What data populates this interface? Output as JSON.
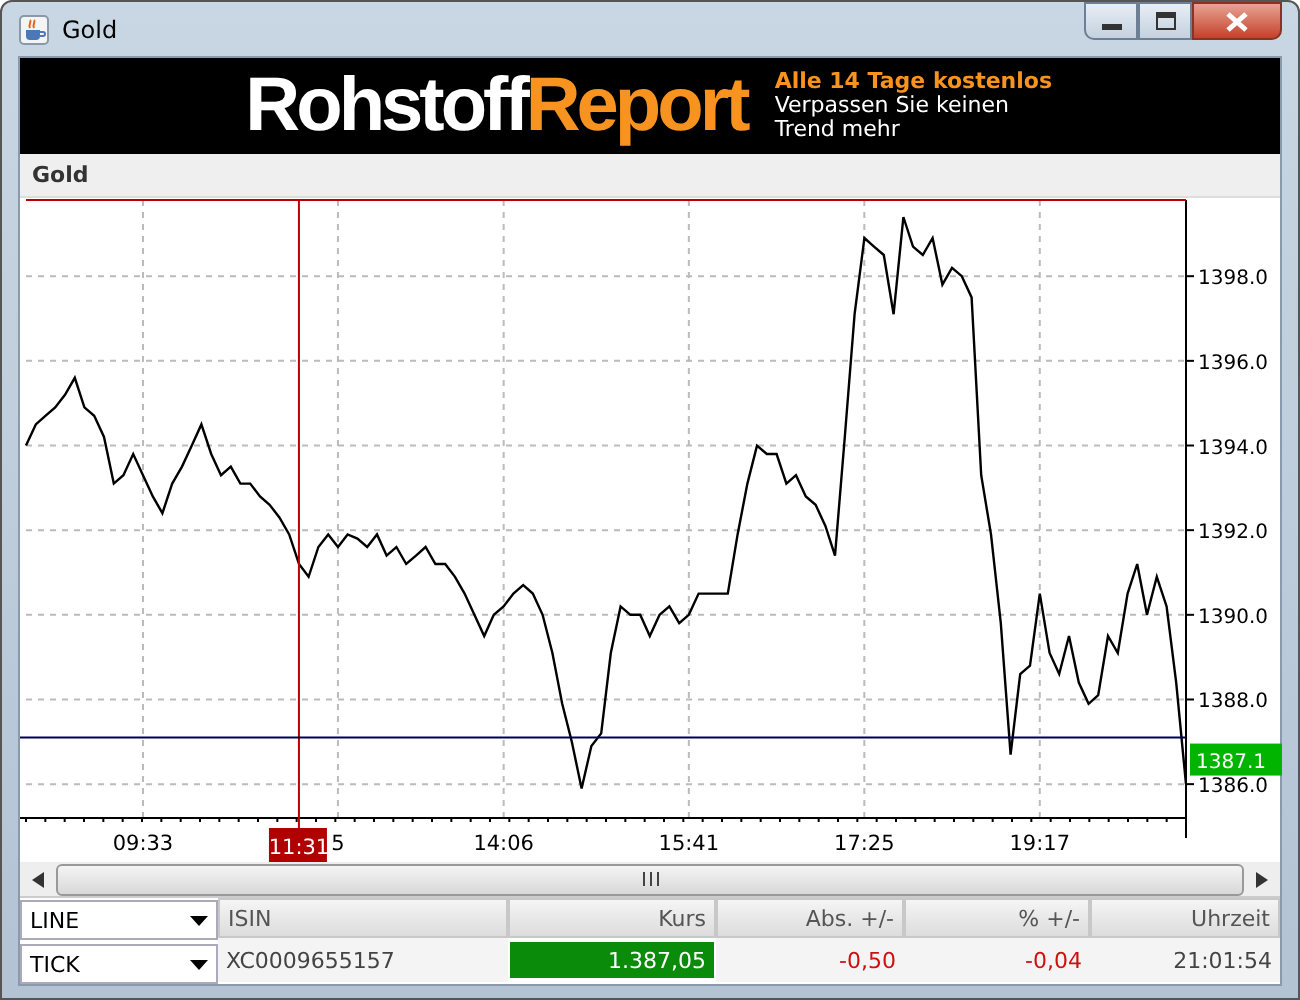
{
  "window": {
    "title": "Gold"
  },
  "banner": {
    "logo": [
      "Rohstoff",
      "Report"
    ],
    "headline": "Alle 14 Tage kostenlos",
    "text": "Verpassen Sie keinen Trend mehr"
  },
  "section": {
    "title": "Gold"
  },
  "chart": {
    "chart_data": {
      "type": "line",
      "grid": true,
      "ylim": [
        1385.2,
        1399.8
      ],
      "categories": [
        null,
        null,
        null,
        null,
        null,
        null,
        null,
        null,
        null,
        null,
        null,
        null,
        "09:33",
        null,
        null,
        null,
        null,
        null,
        null,
        null,
        null,
        null,
        null,
        null,
        null,
        null,
        null,
        null,
        "11:31",
        null,
        null,
        null,
        "5",
        null,
        null,
        null,
        null,
        null,
        null,
        null,
        null,
        null,
        null,
        null,
        null,
        null,
        null,
        null,
        null,
        "14:06",
        null,
        null,
        null,
        null,
        null,
        null,
        null,
        null,
        null,
        null,
        null,
        null,
        null,
        null,
        null,
        null,
        null,
        null,
        "15:41",
        null,
        null,
        null,
        null,
        null,
        null,
        null,
        null,
        null,
        null,
        null,
        null,
        null,
        null,
        null,
        null,
        null,
        "17:25",
        null,
        null,
        null,
        null,
        null,
        null,
        null,
        null,
        null,
        null,
        null,
        null,
        null,
        null,
        null,
        null,
        null,
        "19:17",
        null,
        null,
        null,
        null,
        null,
        null,
        null,
        null,
        null,
        null,
        null,
        null,
        null,
        null,
        null
      ],
      "ref_lines": [
        {
          "axis": "x",
          "value": "11:31",
          "color": "#c00000"
        },
        {
          "axis": "y",
          "value": 1387.1,
          "label": "1387.1",
          "color": "#000050"
        }
      ],
      "yticks": [
        {
          "value": 1386,
          "label": "1386.0"
        },
        {
          "value": 1388,
          "label": "1388.0"
        },
        {
          "value": 1390,
          "label": "1390.0"
        },
        {
          "value": 1392,
          "label": "1392.0"
        },
        {
          "value": 1394,
          "label": "1394.0"
        },
        {
          "value": 1396,
          "label": "1396.0"
        },
        {
          "value": 1398,
          "label": "1398.0"
        }
      ],
      "series": [
        {
          "color": "#000000",
          "values": [
            1394.0,
            1394.5,
            1394.7,
            1394.9,
            1395.2,
            1395.6,
            1394.9,
            1394.7,
            1394.2,
            1393.1,
            1393.3,
            1393.8,
            1393.3,
            1392.8,
            1392.4,
            1393.1,
            1393.5,
            1394.0,
            1394.5,
            1393.8,
            1393.3,
            1393.5,
            1393.1,
            1393.1,
            1392.8,
            1392.6,
            1392.3,
            1391.9,
            1391.2,
            1390.9,
            1391.6,
            1391.9,
            1391.6,
            1391.9,
            1391.8,
            1391.6,
            1391.9,
            1391.4,
            1391.6,
            1391.2,
            1391.4,
            1391.6,
            1391.2,
            1391.2,
            1390.9,
            1390.5,
            1390.0,
            1389.5,
            1390.0,
            1390.2,
            1390.5,
            1390.7,
            1390.5,
            1390.0,
            1389.1,
            1387.9,
            1387.0,
            1385.9,
            1386.9,
            1387.2,
            1389.1,
            1390.2,
            1390.0,
            1390.0,
            1389.5,
            1390.0,
            1390.2,
            1389.8,
            1390.0,
            1390.5,
            1390.5,
            1390.5,
            1390.5,
            1391.9,
            1393.1,
            1394.0,
            1393.8,
            1393.8,
            1393.1,
            1393.3,
            1392.8,
            1392.6,
            1392.1,
            1391.4,
            1394.2,
            1397.1,
            1398.9,
            1398.7,
            1398.5,
            1397.1,
            1399.4,
            1398.7,
            1398.5,
            1398.9,
            1397.8,
            1398.2,
            1398.0,
            1397.5,
            1393.3,
            1391.9,
            1389.8,
            1386.7,
            1388.6,
            1388.8,
            1390.5,
            1389.1,
            1388.6,
            1389.5,
            1388.4,
            1387.9,
            1388.1,
            1389.5,
            1389.1,
            1390.5,
            1391.2,
            1390.0,
            1390.9,
            1390.2,
            1388.4,
            1386.0
          ]
        }
      ]
    }
  },
  "selectors": [
    {
      "value": "LINE"
    },
    {
      "value": "TICK"
    }
  ],
  "table": {
    "columns": [
      "ISIN",
      "Kurs",
      "Abs. +/-",
      "% +/-",
      "Uhrzeit"
    ],
    "rows": [
      {
        "cells": [
          {
            "text": "XC0009655157",
            "highlighted": false,
            "negative": false
          },
          {
            "text": "1.387,05",
            "highlighted": true,
            "negative": false
          },
          {
            "text": "-0,50",
            "highlighted": false,
            "negative": true
          },
          {
            "text": "-0,04",
            "highlighted": false,
            "negative": true
          },
          {
            "text": "21:01:54",
            "highlighted": false,
            "negative": false
          }
        ]
      }
    ]
  }
}
